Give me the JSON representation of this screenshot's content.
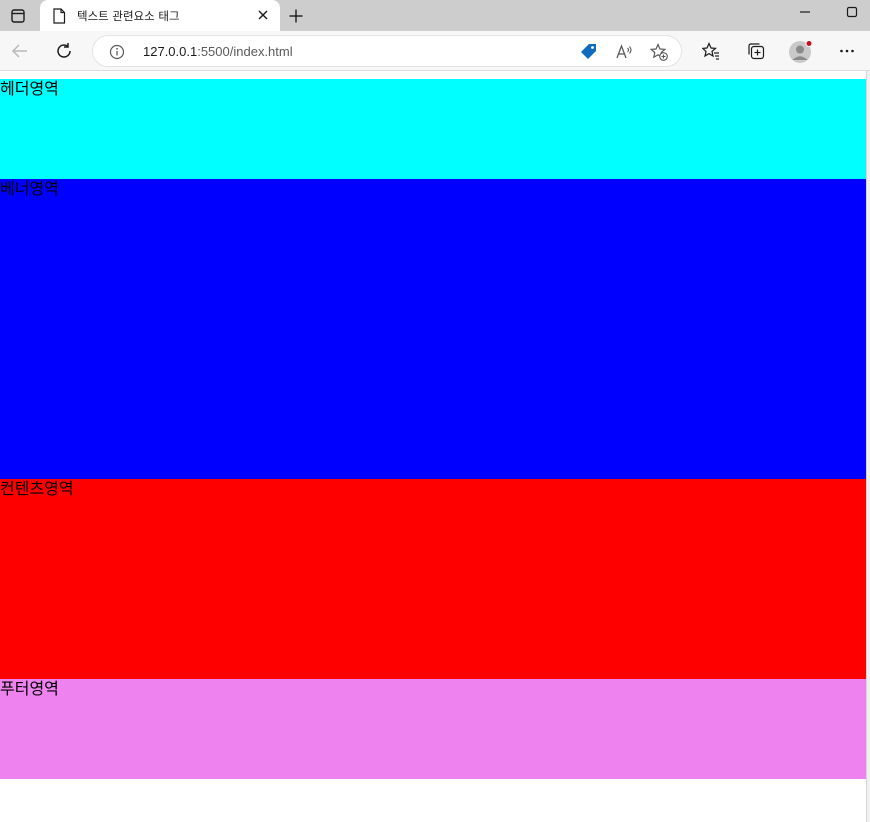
{
  "browser": {
    "tab_title": "텍스트 관련요소 태그",
    "url_host": "127.0.0.1",
    "url_rest": ":5500/index.html"
  },
  "page": {
    "header_text": "헤더영역",
    "banner_text": "베너영역",
    "content_text": "컨텐츠영역",
    "footer_text": "푸터영역"
  },
  "colors": {
    "header": "#00ffff",
    "banner": "#0000ff",
    "content": "#ff0000",
    "footer": "#ee82ee"
  }
}
